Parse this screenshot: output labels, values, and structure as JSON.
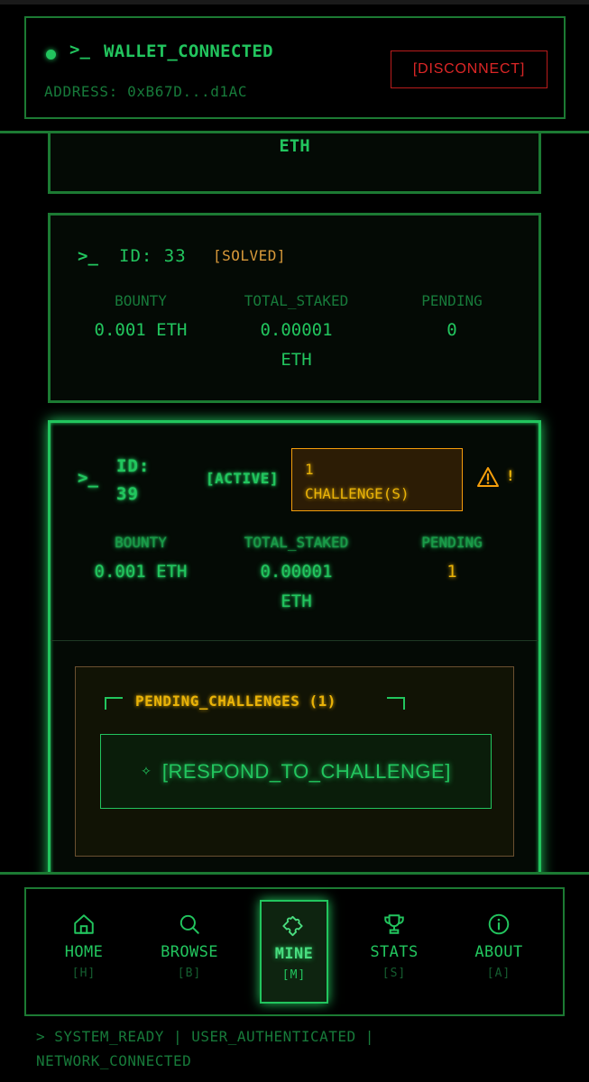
{
  "header": {
    "prompt": ">_",
    "title": "WALLET_CONNECTED",
    "address": "ADDRESS: 0xB67D...d1AC",
    "disconnect_label": "[DISCONNECT]"
  },
  "partial_card": {
    "value_tail": "ETH"
  },
  "cards": [
    {
      "prompt": ">_",
      "id_label": "ID: 33",
      "status": "[SOLVED]",
      "stats": {
        "bounty_label": "BOUNTY",
        "bounty_value": "0.001 ETH",
        "staked_label": "TOTAL_STAKED",
        "staked_value_line1": "0.00001",
        "staked_value_line2": "ETH",
        "pending_label": "PENDING",
        "pending_value": "0"
      }
    },
    {
      "prompt": ">_",
      "id_line1": "ID:",
      "id_line2": "39",
      "status": "[ACTIVE]",
      "challenge_line1": "1",
      "challenge_line2": "CHALLENGE(S)",
      "warning_mark": "!",
      "stats": {
        "bounty_label": "BOUNTY",
        "bounty_value": "0.001 ETH",
        "staked_label": "TOTAL_STAKED",
        "staked_value_line1": "0.00001",
        "staked_value_line2": "ETH",
        "pending_label": "PENDING",
        "pending_value": "1"
      },
      "pending_section": {
        "title": "PENDING_CHALLENGES (1)",
        "respond_icon": "✧",
        "respond_label": "[RESPOND_TO_CHALLENGE]"
      }
    }
  ],
  "nav": {
    "items": [
      {
        "label": "HOME",
        "key": "[H]",
        "icon": "home-icon"
      },
      {
        "label": "BROWSE",
        "key": "[B]",
        "icon": "search-icon"
      },
      {
        "label": "MINE",
        "key": "[M]",
        "icon": "puzzle-icon",
        "active": true
      },
      {
        "label": "STATS",
        "key": "[S]",
        "icon": "trophy-icon"
      },
      {
        "label": "ABOUT",
        "key": "[A]",
        "icon": "info-icon"
      }
    ]
  },
  "status_bar": {
    "line1": "> SYSTEM_READY | USER_AUTHENTICATED |",
    "line2": "NETWORK_CONNECTED"
  },
  "colors": {
    "accent": "#22c55e",
    "warning": "#eab308",
    "danger": "#dc2626",
    "solved": "#d99a3a"
  }
}
